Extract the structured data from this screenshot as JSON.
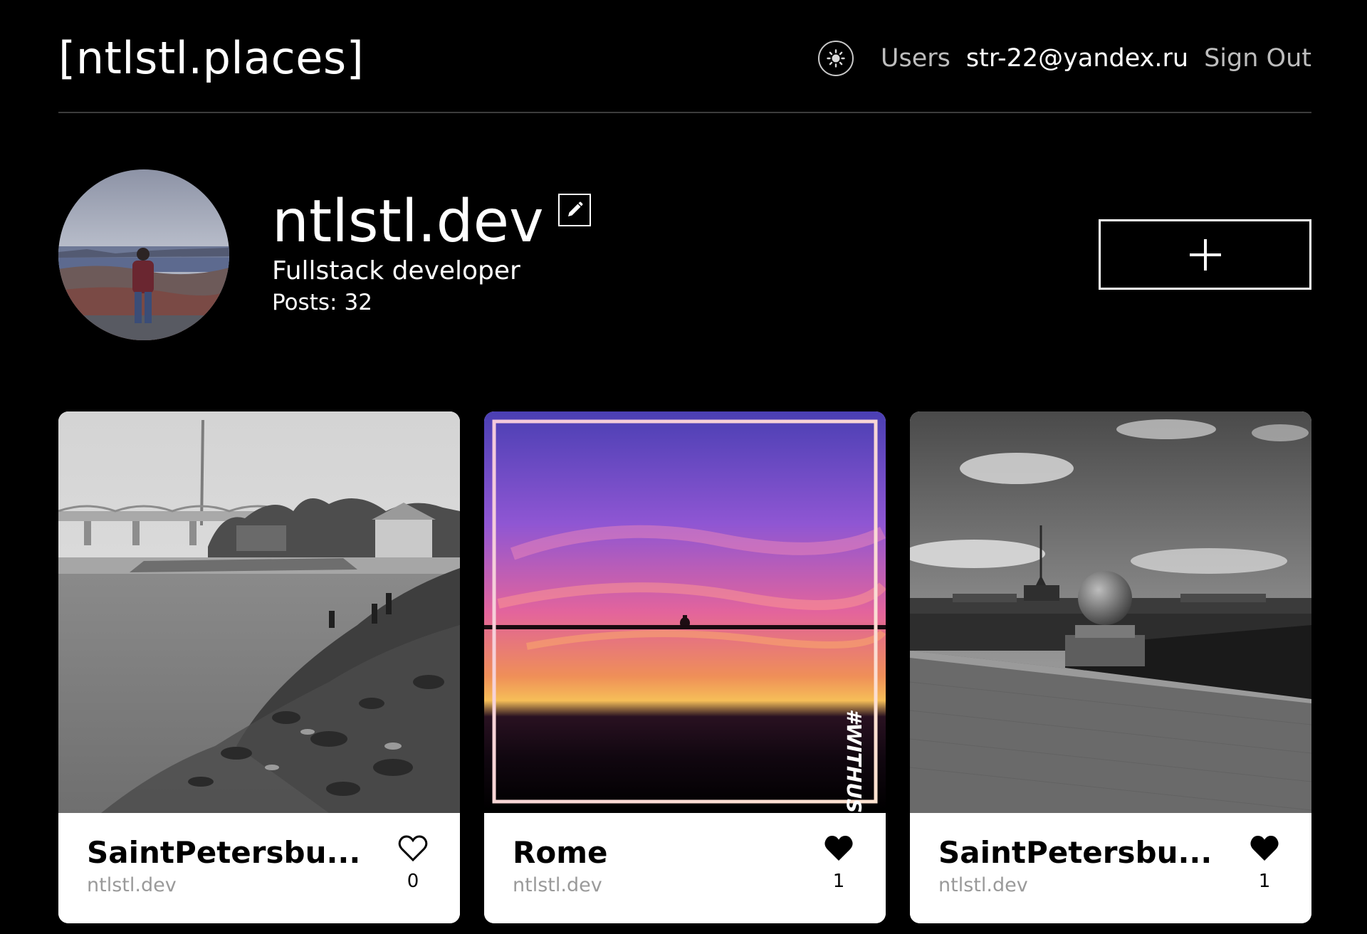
{
  "header": {
    "logo": "[ntlstl.places]",
    "nav": {
      "users": "Users",
      "email": "str-22@yandex.ru",
      "sign_out": "Sign Out"
    },
    "theme_icon": "sun-icon"
  },
  "profile": {
    "name": "ntlstl.dev",
    "about": "Fullstack developer",
    "posts_label": "Posts:",
    "posts_count": "32",
    "edit_icon": "pencil-icon",
    "add_icon": "plus-icon"
  },
  "cards": [
    {
      "title": "SaintPetersbu...",
      "author": "ntlstl.dev",
      "likes": "0",
      "liked": false
    },
    {
      "title": "Rome",
      "author": "ntlstl.dev",
      "likes": "1",
      "liked": true,
      "image_tag": "#WITHUS"
    },
    {
      "title": "SaintPetersbu...",
      "author": "ntlstl.dev",
      "likes": "1",
      "liked": true
    }
  ],
  "colors": {
    "background": "#000000",
    "text": "#ffffff",
    "muted": "#9a9a9a",
    "border": "#3c3c3c"
  }
}
